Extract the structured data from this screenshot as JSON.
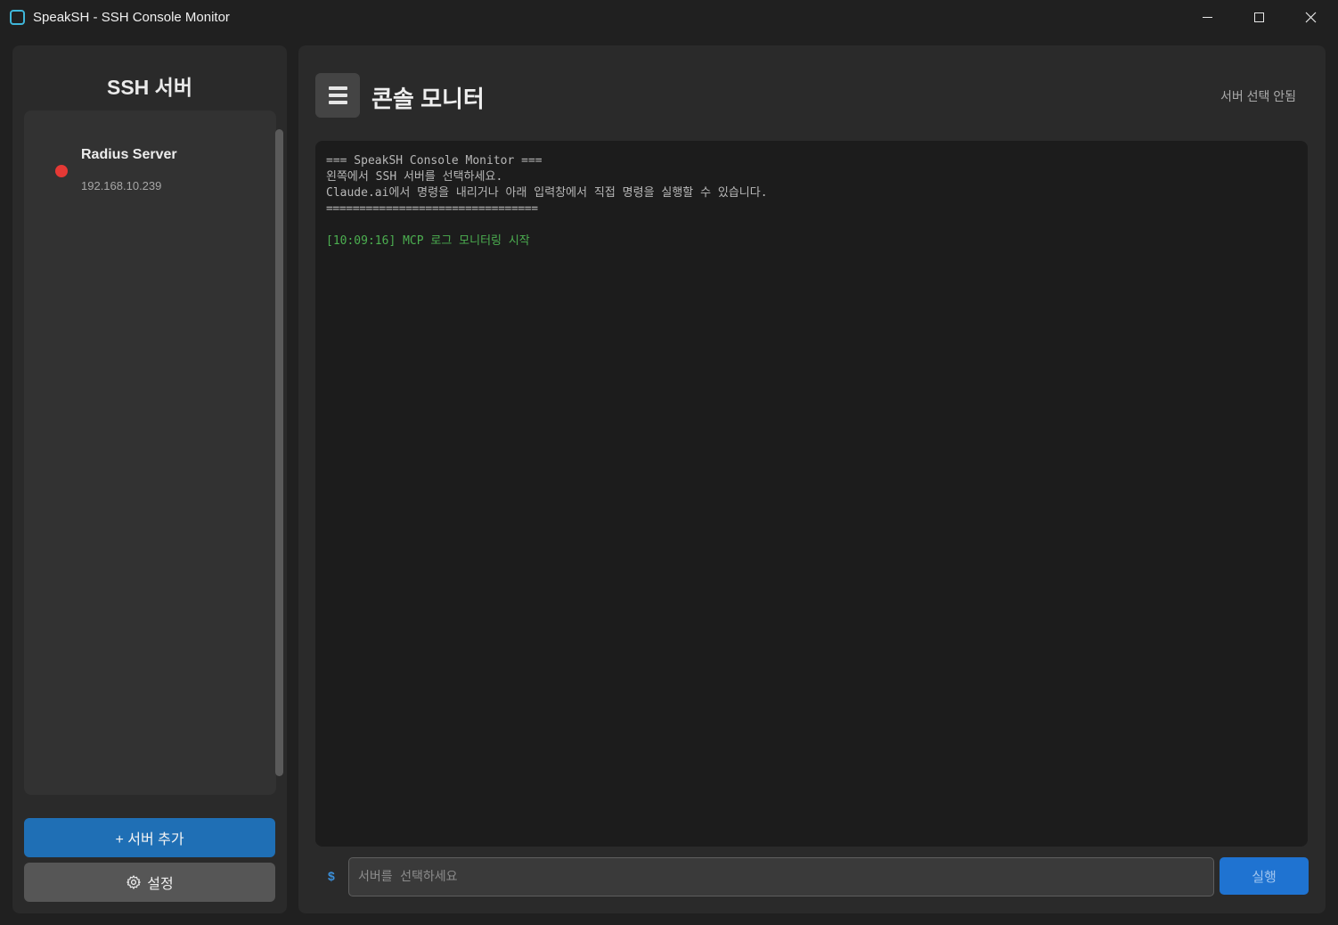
{
  "window": {
    "title": "SpeakSH - SSH Console Monitor",
    "icon": "app-square-icon"
  },
  "sidebar": {
    "title": "SSH 서버",
    "servers": [
      {
        "name": "Radius Server",
        "ip": "192.168.10.239",
        "status_color": "#e53935"
      }
    ],
    "add_server_label": "+ 서버 추가",
    "settings_label": "설정"
  },
  "main": {
    "menu_icon": "hamburger-menu-icon",
    "title": "콘솔 모니터",
    "server_status": "서버 선택 안됨",
    "console": {
      "lines": [
        "=== SpeakSH Console Monitor ===",
        "왼쪽에서 SSH 서버를 선택하세요.",
        "Claude.ai에서 명령을 내리거나 아래 입력창에서 직접 명령을 실행할 수 있습니다.",
        "================================"
      ],
      "log": "[10:09:16] MCP 로그 모니터링 시작"
    },
    "prompt_symbol": "$",
    "command_placeholder": "서버를 선택하세요",
    "run_label": "실행"
  },
  "colors": {
    "accent": "#1f6fb5",
    "run_button": "#1f73d1",
    "log_green": "#4caf50",
    "status_red": "#e53935"
  }
}
